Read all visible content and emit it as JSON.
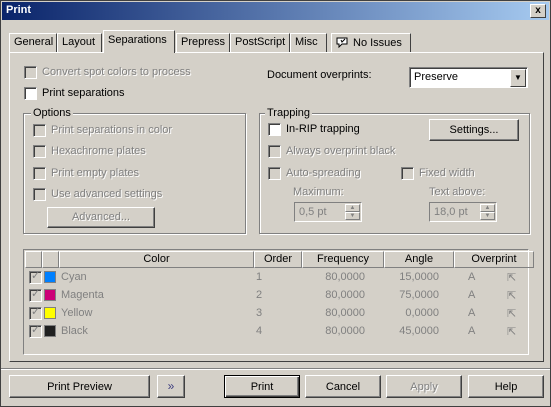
{
  "window": {
    "title": "Print",
    "close_label": "x"
  },
  "tabs": [
    {
      "label": "General"
    },
    {
      "label": "Layout"
    },
    {
      "label": "Separations"
    },
    {
      "label": "Prepress"
    },
    {
      "label": "PostScript"
    },
    {
      "label": "Misc"
    },
    {
      "label": "No Issues"
    }
  ],
  "separations": {
    "convert_spot": "Convert spot colors to process",
    "print_separations": "Print separations",
    "doc_overprints_label": "Document overprints:",
    "doc_overprints_value": "Preserve"
  },
  "options": {
    "title": "Options",
    "items": [
      {
        "label": "Print separations in color"
      },
      {
        "label": "Hexachrome plates"
      },
      {
        "label": "Print empty plates"
      },
      {
        "label": "Use advanced settings"
      }
    ],
    "advanced_button": "Advanced..."
  },
  "trapping": {
    "title": "Trapping",
    "inrip": "In-RIP trapping",
    "settings_button": "Settings...",
    "always_overprint": "Always overprint black",
    "auto_spreading": "Auto-spreading",
    "fixed_width": "Fixed width",
    "maximum_label": "Maximum:",
    "maximum_value": "0,5 pt",
    "text_above_label": "Text above:",
    "text_above_value": "18,0 pt"
  },
  "table": {
    "headers": [
      "Color",
      "Order",
      "Frequency",
      "Angle",
      "Overprint"
    ],
    "rows": [
      {
        "color": "Cyan",
        "order": "1",
        "frequency": "80,0000",
        "angle": "15,0000",
        "swatch": "#0080ff"
      },
      {
        "color": "Magenta",
        "order": "2",
        "frequency": "80,0000",
        "angle": "75,0000",
        "swatch": "#cc0077"
      },
      {
        "color": "Yellow",
        "order": "3",
        "frequency": "80,0000",
        "angle": "0,0000",
        "swatch": "#ffff00"
      },
      {
        "color": "Black",
        "order": "4",
        "frequency": "80,0000",
        "angle": "45,0000",
        "swatch": "#202020"
      }
    ]
  },
  "footer": {
    "print_preview": "Print Preview",
    "print": "Print",
    "cancel": "Cancel",
    "apply": "Apply",
    "help": "Help"
  }
}
